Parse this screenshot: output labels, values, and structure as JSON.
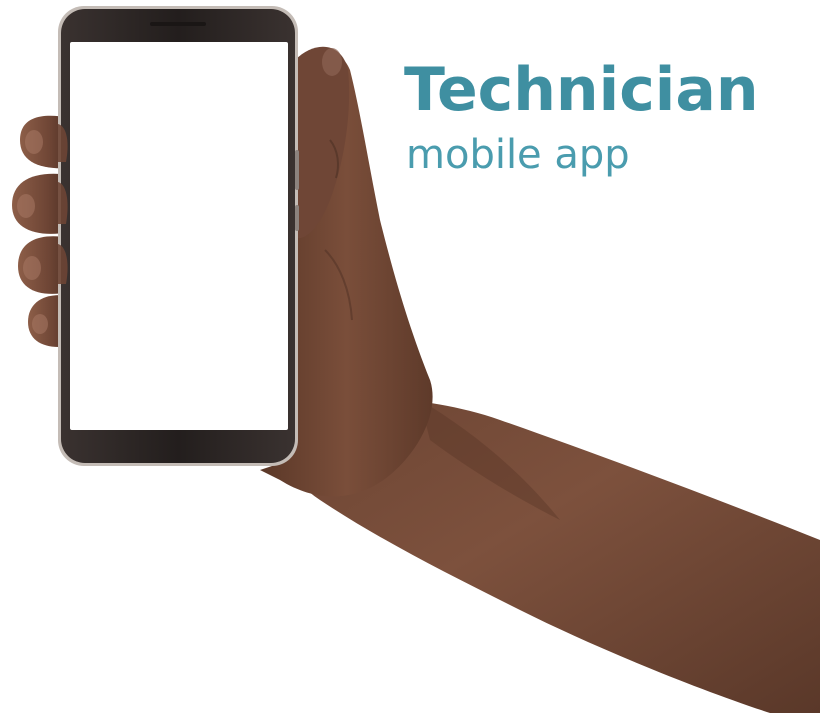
{
  "headline": {
    "title": "Technician",
    "subtitle": "mobile app"
  },
  "colors": {
    "title": "#3f8fa1",
    "subtitle": "#4a9cae",
    "skin_dark": "#4a2f22",
    "skin_mid": "#6b4433",
    "skin_light": "#8a5b45",
    "phone_frame": "#2c2625",
    "phone_bezel": "#b9b1ab",
    "screen": "#ffffff"
  },
  "image": {
    "subject": "hand-holding-phone",
    "screen_state": "blank"
  }
}
